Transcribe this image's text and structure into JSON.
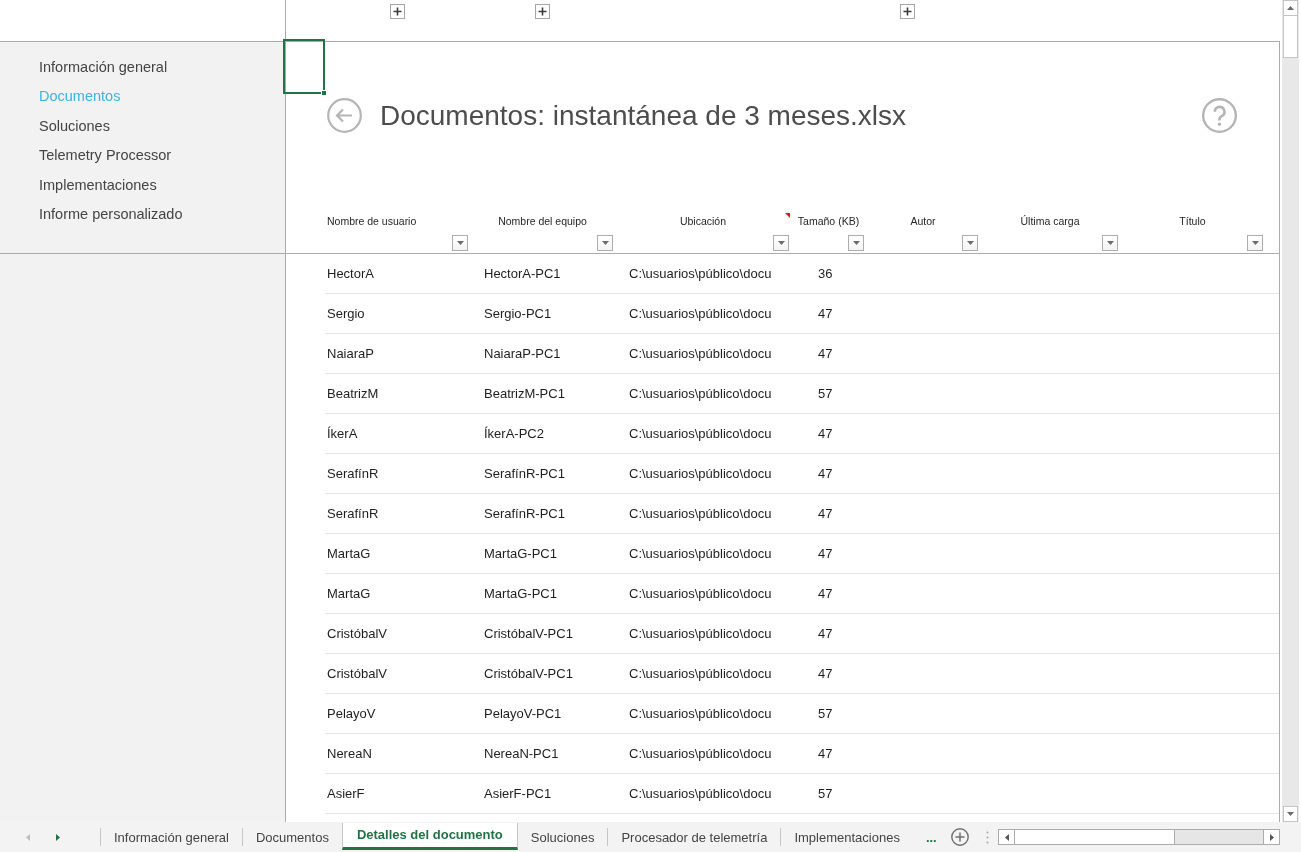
{
  "sidebar": {
    "items": [
      {
        "label": "Información general",
        "selected": false
      },
      {
        "label": "Documentos",
        "selected": true
      },
      {
        "label": "Soluciones",
        "selected": false
      },
      {
        "label": "Telemetry Processor",
        "selected": false
      },
      {
        "label": "Implementaciones",
        "selected": false
      },
      {
        "label": "Informe personalizado",
        "selected": false
      }
    ]
  },
  "report": {
    "title": "Documentos: instantánea de 3 meses.xlsx",
    "columns": [
      {
        "label": "Nombre de usuario",
        "has_comment": false
      },
      {
        "label": "Nombre del equipo",
        "has_comment": false
      },
      {
        "label": "Ubicación",
        "has_comment": true
      },
      {
        "label": "Tamaño (KB)",
        "has_comment": false
      },
      {
        "label": "Autor",
        "has_comment": false
      },
      {
        "label": "Última carga",
        "has_comment": false
      },
      {
        "label": "Título",
        "has_comment": false
      }
    ],
    "rows": [
      [
        "HectorA",
        "HectorA-PC1",
        "C:\\usuarios\\público\\docu",
        "36"
      ],
      [
        "Sergio",
        "Sergio-PC1",
        "C:\\usuarios\\público\\docu",
        "47"
      ],
      [
        "NaiaraP",
        "NaiaraP-PC1",
        "C:\\usuarios\\público\\docu",
        "47"
      ],
      [
        "BeatrizM",
        "BeatrizM-PC1",
        "C:\\usuarios\\público\\docu",
        "57"
      ],
      [
        "ÍkerA",
        "ÍkerA-PC2",
        "C:\\usuarios\\público\\docu",
        "47"
      ],
      [
        "SerafínR",
        "SerafínR-PC1",
        "C:\\usuarios\\público\\docu",
        "47"
      ],
      [
        "SerafínR",
        "SerafínR-PC1",
        "C:\\usuarios\\público\\docu",
        "47"
      ],
      [
        "MartaG",
        "MartaG-PC1",
        "C:\\usuarios\\público\\docu",
        "47"
      ],
      [
        "MartaG",
        "MartaG-PC1",
        "C:\\usuarios\\público\\docu",
        "47"
      ],
      [
        "CristóbalV",
        "CristóbalV-PC1",
        "C:\\usuarios\\público\\docu",
        "47"
      ],
      [
        "CristóbalV",
        "CristóbalV-PC1",
        "C:\\usuarios\\público\\docu",
        "47"
      ],
      [
        "PelayoV",
        "PelayoV-PC1",
        "C:\\usuarios\\público\\docu",
        "57"
      ],
      [
        "NereaN",
        "NereaN-PC1",
        "C:\\usuarios\\público\\docu",
        "47"
      ],
      [
        "AsierF",
        "AsierF-PC1",
        "C:\\usuarios\\público\\docu",
        "57"
      ]
    ]
  },
  "sheet_tabs": {
    "scroll_buttons": [
      {
        "disabled": true
      },
      {
        "disabled": false
      }
    ],
    "tabs": [
      {
        "label": "Información general",
        "selected": false
      },
      {
        "label": "Documentos",
        "selected": false
      },
      {
        "label": "Detalles del documento",
        "selected": true
      },
      {
        "label": "Soluciones",
        "selected": false
      },
      {
        "label": "Procesador de telemetría",
        "selected": false
      },
      {
        "label": "Implementaciones",
        "selected": false
      }
    ],
    "more": "..."
  }
}
